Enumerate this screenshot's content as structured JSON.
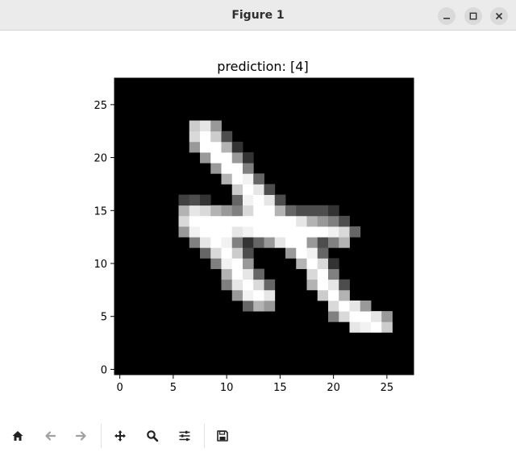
{
  "window": {
    "title": "Figure 1",
    "controls": [
      {
        "name": "minimize-button",
        "icon": "minimize-icon"
      },
      {
        "name": "maximize-button",
        "icon": "maximize-icon"
      },
      {
        "name": "close-button",
        "icon": "close-icon"
      }
    ]
  },
  "figure": {
    "title": "prediction: [4]"
  },
  "chart_data": {
    "type": "heatmap",
    "title": "prediction: [4]",
    "colormap": "gray",
    "xlabel": "",
    "ylabel": "",
    "xlim": [
      -0.5,
      27.5
    ],
    "ylim": [
      27.5,
      -0.5
    ],
    "xticks": [
      0,
      5,
      10,
      15,
      20,
      25
    ],
    "yticks": [
      0,
      5,
      10,
      15,
      20,
      25
    ],
    "xtick_labels": [
      "0",
      "5",
      "10",
      "15",
      "20",
      "25"
    ],
    "ytick_labels": [
      "0",
      "5",
      "10",
      "15",
      "20",
      "25"
    ],
    "grid": false,
    "rows": 28,
    "cols": 28,
    "pixels": [
      {
        "r": 5,
        "c": 22,
        "v": 0.9
      },
      {
        "r": 5,
        "c": 23,
        "v": 0.95
      },
      {
        "r": 5,
        "c": 24,
        "v": 1
      },
      {
        "r": 5,
        "c": 25,
        "v": 0.8
      },
      {
        "r": 6,
        "c": 20,
        "v": 0.5
      },
      {
        "r": 6,
        "c": 21,
        "v": 0.85
      },
      {
        "r": 6,
        "c": 22,
        "v": 1
      },
      {
        "r": 6,
        "c": 23,
        "v": 1
      },
      {
        "r": 6,
        "c": 24,
        "v": 0.9
      },
      {
        "r": 6,
        "c": 25,
        "v": 0.6
      },
      {
        "r": 7,
        "c": 12,
        "v": 0.4
      },
      {
        "r": 7,
        "c": 13,
        "v": 0.7
      },
      {
        "r": 7,
        "c": 14,
        "v": 0.6
      },
      {
        "r": 7,
        "c": 20,
        "v": 0.85
      },
      {
        "r": 7,
        "c": 21,
        "v": 1
      },
      {
        "r": 7,
        "c": 22,
        "v": 0.9
      },
      {
        "r": 7,
        "c": 23,
        "v": 0.6
      },
      {
        "r": 8,
        "c": 11,
        "v": 0.6
      },
      {
        "r": 8,
        "c": 12,
        "v": 0.95
      },
      {
        "r": 8,
        "c": 13,
        "v": 1
      },
      {
        "r": 8,
        "c": 14,
        "v": 0.9
      },
      {
        "r": 8,
        "c": 19,
        "v": 0.8
      },
      {
        "r": 8,
        "c": 20,
        "v": 1
      },
      {
        "r": 8,
        "c": 21,
        "v": 0.7
      },
      {
        "r": 9,
        "c": 10,
        "v": 0.5
      },
      {
        "r": 9,
        "c": 11,
        "v": 0.9
      },
      {
        "r": 9,
        "c": 12,
        "v": 1
      },
      {
        "r": 9,
        "c": 13,
        "v": 0.85
      },
      {
        "r": 9,
        "c": 14,
        "v": 0.4
      },
      {
        "r": 9,
        "c": 18,
        "v": 0.7
      },
      {
        "r": 9,
        "c": 19,
        "v": 1
      },
      {
        "r": 9,
        "c": 20,
        "v": 0.9
      },
      {
        "r": 9,
        "c": 21,
        "v": 0.3
      },
      {
        "r": 10,
        "c": 10,
        "v": 0.7
      },
      {
        "r": 10,
        "c": 11,
        "v": 1
      },
      {
        "r": 10,
        "c": 12,
        "v": 0.9
      },
      {
        "r": 10,
        "c": 13,
        "v": 0.4
      },
      {
        "r": 10,
        "c": 18,
        "v": 0.85
      },
      {
        "r": 10,
        "c": 19,
        "v": 1
      },
      {
        "r": 10,
        "c": 20,
        "v": 0.5
      },
      {
        "r": 11,
        "c": 9,
        "v": 0.5
      },
      {
        "r": 11,
        "c": 10,
        "v": 0.95
      },
      {
        "r": 11,
        "c": 11,
        "v": 1
      },
      {
        "r": 11,
        "c": 12,
        "v": 0.6
      },
      {
        "r": 11,
        "c": 17,
        "v": 0.7
      },
      {
        "r": 11,
        "c": 18,
        "v": 1
      },
      {
        "r": 11,
        "c": 19,
        "v": 0.85
      },
      {
        "r": 11,
        "c": 20,
        "v": 0.2
      },
      {
        "r": 12,
        "c": 8,
        "v": 0.4
      },
      {
        "r": 12,
        "c": 9,
        "v": 0.85
      },
      {
        "r": 12,
        "c": 10,
        "v": 1
      },
      {
        "r": 12,
        "c": 11,
        "v": 0.8
      },
      {
        "r": 12,
        "c": 12,
        "v": 0.3
      },
      {
        "r": 12,
        "c": 16,
        "v": 0.6
      },
      {
        "r": 12,
        "c": 17,
        "v": 1
      },
      {
        "r": 12,
        "c": 18,
        "v": 0.95
      },
      {
        "r": 12,
        "c": 19,
        "v": 0.4
      },
      {
        "r": 13,
        "c": 7,
        "v": 0.5
      },
      {
        "r": 13,
        "c": 8,
        "v": 0.9
      },
      {
        "r": 13,
        "c": 9,
        "v": 1
      },
      {
        "r": 13,
        "c": 10,
        "v": 0.95
      },
      {
        "r": 13,
        "c": 11,
        "v": 0.5
      },
      {
        "r": 13,
        "c": 12,
        "v": 0.2
      },
      {
        "r": 13,
        "c": 13,
        "v": 0.4
      },
      {
        "r": 13,
        "c": 14,
        "v": 0.6
      },
      {
        "r": 13,
        "c": 15,
        "v": 0.9
      },
      {
        "r": 13,
        "c": 16,
        "v": 1
      },
      {
        "r": 13,
        "c": 17,
        "v": 1
      },
      {
        "r": 13,
        "c": 18,
        "v": 0.6
      },
      {
        "r": 13,
        "c": 19,
        "v": 0.3
      },
      {
        "r": 13,
        "c": 20,
        "v": 0.5
      },
      {
        "r": 13,
        "c": 21,
        "v": 0.7
      },
      {
        "r": 14,
        "c": 6,
        "v": 0.6
      },
      {
        "r": 14,
        "c": 7,
        "v": 0.95
      },
      {
        "r": 14,
        "c": 8,
        "v": 1
      },
      {
        "r": 14,
        "c": 9,
        "v": 1
      },
      {
        "r": 14,
        "c": 10,
        "v": 1
      },
      {
        "r": 14,
        "c": 11,
        "v": 0.9
      },
      {
        "r": 14,
        "c": 12,
        "v": 0.95
      },
      {
        "r": 14,
        "c": 13,
        "v": 1
      },
      {
        "r": 14,
        "c": 14,
        "v": 1
      },
      {
        "r": 14,
        "c": 15,
        "v": 1
      },
      {
        "r": 14,
        "c": 16,
        "v": 1
      },
      {
        "r": 14,
        "c": 17,
        "v": 1
      },
      {
        "r": 14,
        "c": 18,
        "v": 1
      },
      {
        "r": 14,
        "c": 19,
        "v": 1
      },
      {
        "r": 14,
        "c": 20,
        "v": 0.95
      },
      {
        "r": 14,
        "c": 21,
        "v": 0.85
      },
      {
        "r": 14,
        "c": 22,
        "v": 0.4
      },
      {
        "r": 15,
        "c": 6,
        "v": 0.85
      },
      {
        "r": 15,
        "c": 7,
        "v": 1
      },
      {
        "r": 15,
        "c": 8,
        "v": 1
      },
      {
        "r": 15,
        "c": 9,
        "v": 1
      },
      {
        "r": 15,
        "c": 10,
        "v": 1
      },
      {
        "r": 15,
        "c": 11,
        "v": 1
      },
      {
        "r": 15,
        "c": 12,
        "v": 1
      },
      {
        "r": 15,
        "c": 13,
        "v": 1
      },
      {
        "r": 15,
        "c": 14,
        "v": 1
      },
      {
        "r": 15,
        "c": 15,
        "v": 1
      },
      {
        "r": 15,
        "c": 16,
        "v": 1
      },
      {
        "r": 15,
        "c": 17,
        "v": 0.9
      },
      {
        "r": 15,
        "c": 18,
        "v": 0.7
      },
      {
        "r": 15,
        "c": 19,
        "v": 0.6
      },
      {
        "r": 15,
        "c": 20,
        "v": 0.5
      },
      {
        "r": 15,
        "c": 21,
        "v": 0.3
      },
      {
        "r": 16,
        "c": 6,
        "v": 0.7
      },
      {
        "r": 16,
        "c": 7,
        "v": 0.9
      },
      {
        "r": 16,
        "c": 8,
        "v": 0.85
      },
      {
        "r": 16,
        "c": 9,
        "v": 0.7
      },
      {
        "r": 16,
        "c": 10,
        "v": 0.6
      },
      {
        "r": 16,
        "c": 11,
        "v": 0.5
      },
      {
        "r": 16,
        "c": 12,
        "v": 0.85
      },
      {
        "r": 16,
        "c": 13,
        "v": 1
      },
      {
        "r": 16,
        "c": 14,
        "v": 1
      },
      {
        "r": 16,
        "c": 15,
        "v": 0.7
      },
      {
        "r": 16,
        "c": 16,
        "v": 0.4
      },
      {
        "r": 16,
        "c": 17,
        "v": 0.3
      },
      {
        "r": 16,
        "c": 18,
        "v": 0.3
      },
      {
        "r": 16,
        "c": 19,
        "v": 0.3
      },
      {
        "r": 16,
        "c": 20,
        "v": 0.2
      },
      {
        "r": 17,
        "c": 6,
        "v": 0.25
      },
      {
        "r": 17,
        "c": 7,
        "v": 0.3
      },
      {
        "r": 17,
        "c": 8,
        "v": 0.2
      },
      {
        "r": 17,
        "c": 11,
        "v": 0.4
      },
      {
        "r": 17,
        "c": 12,
        "v": 0.95
      },
      {
        "r": 17,
        "c": 13,
        "v": 1
      },
      {
        "r": 17,
        "c": 14,
        "v": 0.9
      },
      {
        "r": 17,
        "c": 15,
        "v": 0.3
      },
      {
        "r": 18,
        "c": 11,
        "v": 0.8
      },
      {
        "r": 18,
        "c": 12,
        "v": 1
      },
      {
        "r": 18,
        "c": 13,
        "v": 0.9
      },
      {
        "r": 18,
        "c": 14,
        "v": 0.3
      },
      {
        "r": 19,
        "c": 10,
        "v": 0.7
      },
      {
        "r": 19,
        "c": 11,
        "v": 1
      },
      {
        "r": 19,
        "c": 12,
        "v": 0.95
      },
      {
        "r": 19,
        "c": 13,
        "v": 0.4
      },
      {
        "r": 20,
        "c": 9,
        "v": 0.6
      },
      {
        "r": 20,
        "c": 10,
        "v": 1
      },
      {
        "r": 20,
        "c": 11,
        "v": 1
      },
      {
        "r": 20,
        "c": 12,
        "v": 0.5
      },
      {
        "r": 21,
        "c": 8,
        "v": 0.6
      },
      {
        "r": 21,
        "c": 9,
        "v": 1
      },
      {
        "r": 21,
        "c": 10,
        "v": 1
      },
      {
        "r": 21,
        "c": 11,
        "v": 0.6
      },
      {
        "r": 21,
        "c": 12,
        "v": 0.2
      },
      {
        "r": 22,
        "c": 7,
        "v": 0.6
      },
      {
        "r": 22,
        "c": 8,
        "v": 1
      },
      {
        "r": 22,
        "c": 9,
        "v": 1
      },
      {
        "r": 22,
        "c": 10,
        "v": 0.7
      },
      {
        "r": 22,
        "c": 11,
        "v": 0.2
      },
      {
        "r": 23,
        "c": 7,
        "v": 0.85
      },
      {
        "r": 23,
        "c": 8,
        "v": 1
      },
      {
        "r": 23,
        "c": 9,
        "v": 0.8
      },
      {
        "r": 23,
        "c": 10,
        "v": 0.3
      },
      {
        "r": 24,
        "c": 7,
        "v": 0.8
      },
      {
        "r": 24,
        "c": 8,
        "v": 0.9
      },
      {
        "r": 24,
        "c": 9,
        "v": 0.6
      }
    ]
  },
  "toolbar": {
    "tools": [
      {
        "name": "home-button",
        "icon": "home-icon",
        "enabled": true
      },
      {
        "name": "back-button",
        "icon": "arrow-left-icon",
        "enabled": false
      },
      {
        "name": "forward-button",
        "icon": "arrow-right-icon",
        "enabled": false
      },
      {
        "name": "pan-button",
        "icon": "move-arrows-icon",
        "enabled": true
      },
      {
        "name": "zoom-button",
        "icon": "magnifier-icon",
        "enabled": true
      },
      {
        "name": "configure-subplots-button",
        "icon": "sliders-icon",
        "enabled": true
      },
      {
        "name": "save-button",
        "icon": "floppy-disk-icon",
        "enabled": true
      }
    ]
  },
  "colors": {
    "titlebar": "#ebebeb",
    "title_text": "#2e2e2e",
    "window_button": "#dadada",
    "axes_background": "#000000",
    "text": "#000000",
    "disabled_icon": "#a0a0a0",
    "icon": "#222222"
  }
}
